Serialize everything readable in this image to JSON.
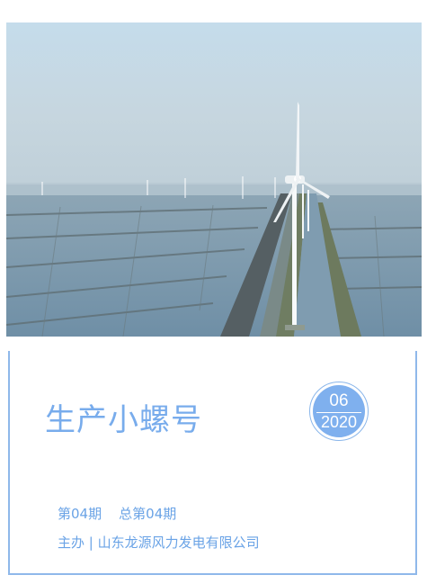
{
  "cover": {
    "title": "生产小螺号",
    "date": {
      "month": "06",
      "year": "2020"
    },
    "issue_line": "第04期    总第04期",
    "sponsor_line": "主办 | 山东龙源风力发电有限公司"
  },
  "colors": {
    "accent": "#78acec",
    "badge": "#7fb0ee",
    "border": "#8fb8ea"
  }
}
